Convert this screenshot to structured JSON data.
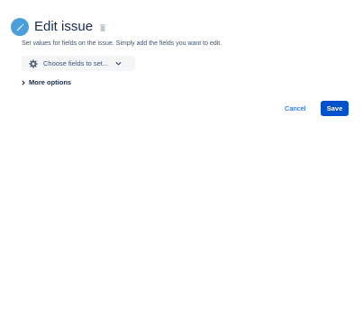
{
  "header": {
    "title": "Edit issue",
    "edit_icon": "pencil-icon",
    "delete_icon": "trash-icon"
  },
  "description": "Set values for fields on the issue. Simply add the fields you want to edit.",
  "fields_picker": {
    "label": "Choose fields to set...",
    "icon": "gear-icon",
    "chevron": "chevron-down-icon"
  },
  "more_options": {
    "label": "More options",
    "icon": "chevron-right-icon"
  },
  "actions": {
    "cancel_label": "Cancel",
    "save_label": "Save"
  },
  "colors": {
    "accent": "#0052cc",
    "badge": "#4a9fd8",
    "text": "#172b4d",
    "muted": "#42526e",
    "button_bg": "#f4f5f7"
  }
}
